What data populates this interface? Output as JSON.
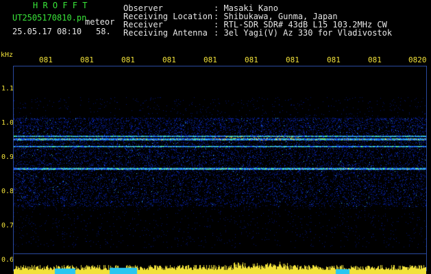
{
  "header": {
    "station": "H R O F F T",
    "filename": "UT2505170810.pn",
    "tag": "meteor",
    "datetime": "25.05.17 08:10",
    "count": "58.",
    "observer_label": "Observer",
    "observer_value": ": Masaki Kano",
    "location_label": "Receiving Location",
    "location_value": ": Shibukawa, Gunma, Japan",
    "receiver_label": "Receiver",
    "receiver_value": ": RTL-SDR SDR# 43dB L15 103.2MHz CW",
    "antenna_label": "Receiving Antenna",
    "antenna_value": ": 3el Yagi(V) Az 330 for Vladivostok"
  },
  "axis": {
    "unit": "kHz",
    "y_ticks": [
      "1.1",
      "1.0",
      "0.9",
      "0.8",
      "0.7",
      "0.6"
    ],
    "x_ticks": [
      "081",
      "081",
      "081",
      "081",
      "081",
      "081",
      "081",
      "081",
      "081",
      "0820"
    ]
  },
  "colors": {
    "label_green": "#39e639",
    "axis_yellow": "#f2e23a",
    "background": "#000000",
    "spectrogram_base": "#00106a"
  }
}
